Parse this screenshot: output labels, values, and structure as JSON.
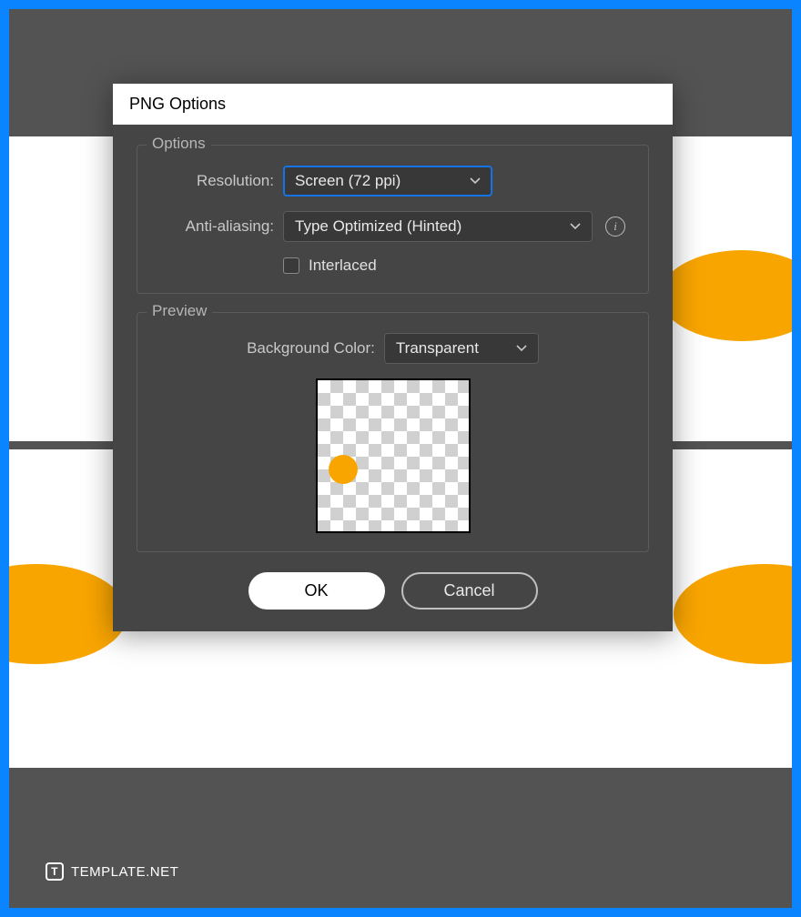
{
  "dialog": {
    "title": "PNG Options",
    "options": {
      "legend": "Options",
      "resolution_label": "Resolution:",
      "resolution_value": "Screen (72 ppi)",
      "antialiasing_label": "Anti-aliasing:",
      "antialiasing_value": "Type Optimized (Hinted)",
      "interlaced_label": "Interlaced",
      "interlaced_checked": false
    },
    "preview": {
      "legend": "Preview",
      "bgcolor_label": "Background Color:",
      "bgcolor_value": "Transparent"
    },
    "buttons": {
      "ok": "OK",
      "cancel": "Cancel"
    }
  },
  "watermark": {
    "icon_letter": "T",
    "text": "TEMPLATE.NET"
  },
  "colors": {
    "accent_orange": "#f9a500",
    "focus_blue": "#1473e6"
  }
}
